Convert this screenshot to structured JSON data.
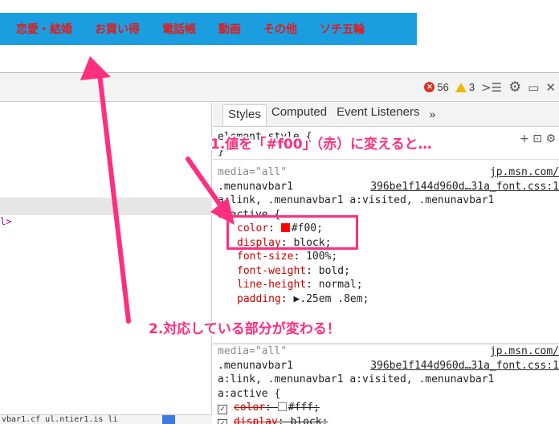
{
  "navbar": {
    "items": [
      "恋愛・結婚",
      "お買い得",
      "電話帳",
      "動画",
      "その他",
      "ソチ五輪"
    ],
    "bg_color": "#1a9ee0",
    "text_color": "#e21b1b"
  },
  "toolbar": {
    "errors": "56",
    "warnings": "3",
    "icons": [
      "error-icon",
      "warning-icon",
      "console-drawer-icon",
      "gear-icon",
      "dock-icon",
      "close-icon"
    ]
  },
  "left": {
    "code_fragment": "l>",
    "bottom_text": "vbar1.cf    ul.ntier1.is   li"
  },
  "tabs": {
    "styles": "Styles",
    "computed": "Computed",
    "event_listeners": "Event Listeners",
    "more": "»"
  },
  "filter": {
    "text": "element.style {",
    "close_brace": "}",
    "icons": "+ ⊡ ⚙"
  },
  "rule1": {
    "media": "media=\"all\"",
    "source": "jp.msn.com/",
    "selector_line1": ".menunavbar1",
    "source2": "396be1f144d960d…31a_font.css:1",
    "selector_line2": "a:link, .menunavbar1 a:visited, .menunavbar1",
    "selector_line3": "a:active {",
    "props": [
      {
        "name": "color",
        "value": "#f00;",
        "swatch": "#ff0000"
      },
      {
        "name": "display",
        "value": "block;"
      },
      {
        "name": "font-size",
        "value": "100%;"
      },
      {
        "name": "font-weight",
        "value": "bold;"
      },
      {
        "name": "line-height",
        "value": "normal;"
      },
      {
        "name": "padding",
        "value": "▶.25em .8em;"
      }
    ]
  },
  "rule2": {
    "media": "media=\"all\"",
    "source": "jp.msn.com/",
    "selector_line1": ".menunavbar1",
    "source2": "396be1f144d960d…31a_font.css:1",
    "selector_line2": "a:link, .menunavbar1 a:visited, .menunavbar1",
    "selector_line3": "a:active {",
    "props": [
      {
        "name": "color",
        "value": "#fff;",
        "swatch": "#ffffff"
      },
      {
        "name": "display",
        "value": "block;"
      }
    ]
  },
  "annotations": {
    "step1": "1.値を「#f00」（赤）に変えると…",
    "step2": "2.対応している部分が変わる！",
    "color": "#ff2e7e"
  }
}
